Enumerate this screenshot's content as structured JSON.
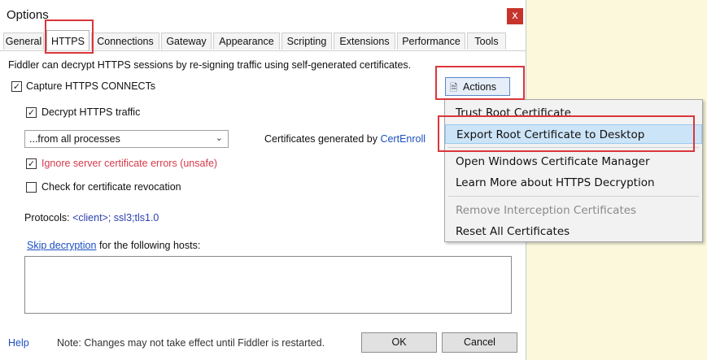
{
  "window": {
    "title": "Options",
    "close_glyph": "x"
  },
  "tabs": [
    {
      "label": "General"
    },
    {
      "label": "HTTPS"
    },
    {
      "label": "Connections"
    },
    {
      "label": "Gateway"
    },
    {
      "label": "Appearance"
    },
    {
      "label": "Scripting"
    },
    {
      "label": "Extensions"
    },
    {
      "label": "Performance"
    },
    {
      "label": "Tools"
    }
  ],
  "active_tab": "HTTPS",
  "https": {
    "description": "Fiddler can decrypt HTTPS sessions by re-signing traffic using self-generated certificates.",
    "capture_label": "Capture HTTPS CONNECTs",
    "decrypt_label": "Decrypt HTTPS traffic",
    "process_select": "...from all processes",
    "certs_prefix": "Certificates generated by ",
    "certs_engine": "CertEnroll",
    "ignore_errors_label": "Ignore server certificate errors (unsafe)",
    "revocation_label": "Check for certificate revocation",
    "protocols_label": "Protocols: ",
    "protocols_value": "<client>; ssl3;tls1.0",
    "skip_link": "Skip decryption",
    "skip_suffix": " for the following hosts:",
    "hosts_value": ""
  },
  "checkboxes": {
    "capture": true,
    "decrypt": true,
    "ignore_errors": true,
    "revocation": false
  },
  "actions_button": {
    "label": "Actions",
    "icon": "certificate-icon"
  },
  "actions_menu": [
    {
      "label": "Trust Root Certificate",
      "enabled": true
    },
    {
      "label": "Export Root Certificate to Desktop",
      "enabled": true,
      "highlighted": true
    },
    {
      "label": "Open Windows Certificate Manager",
      "enabled": true
    },
    {
      "label": "Learn More about HTTPS Decryption",
      "enabled": true
    },
    {
      "label": "Remove Interception Certificates",
      "enabled": false
    },
    {
      "label": "Reset All Certificates",
      "enabled": true
    }
  ],
  "footer": {
    "help": "Help",
    "note": "Note: Changes may not take effect until Fiddler is restarted.",
    "ok": "OK",
    "cancel": "Cancel"
  },
  "colors": {
    "annotation_red": "#d9363a",
    "link_blue": "#1b4fc0",
    "warning_red": "#d43a4a",
    "menu_highlight": "#cce4f7",
    "close_button": "#c6342b",
    "background": "#fbf8dc"
  }
}
